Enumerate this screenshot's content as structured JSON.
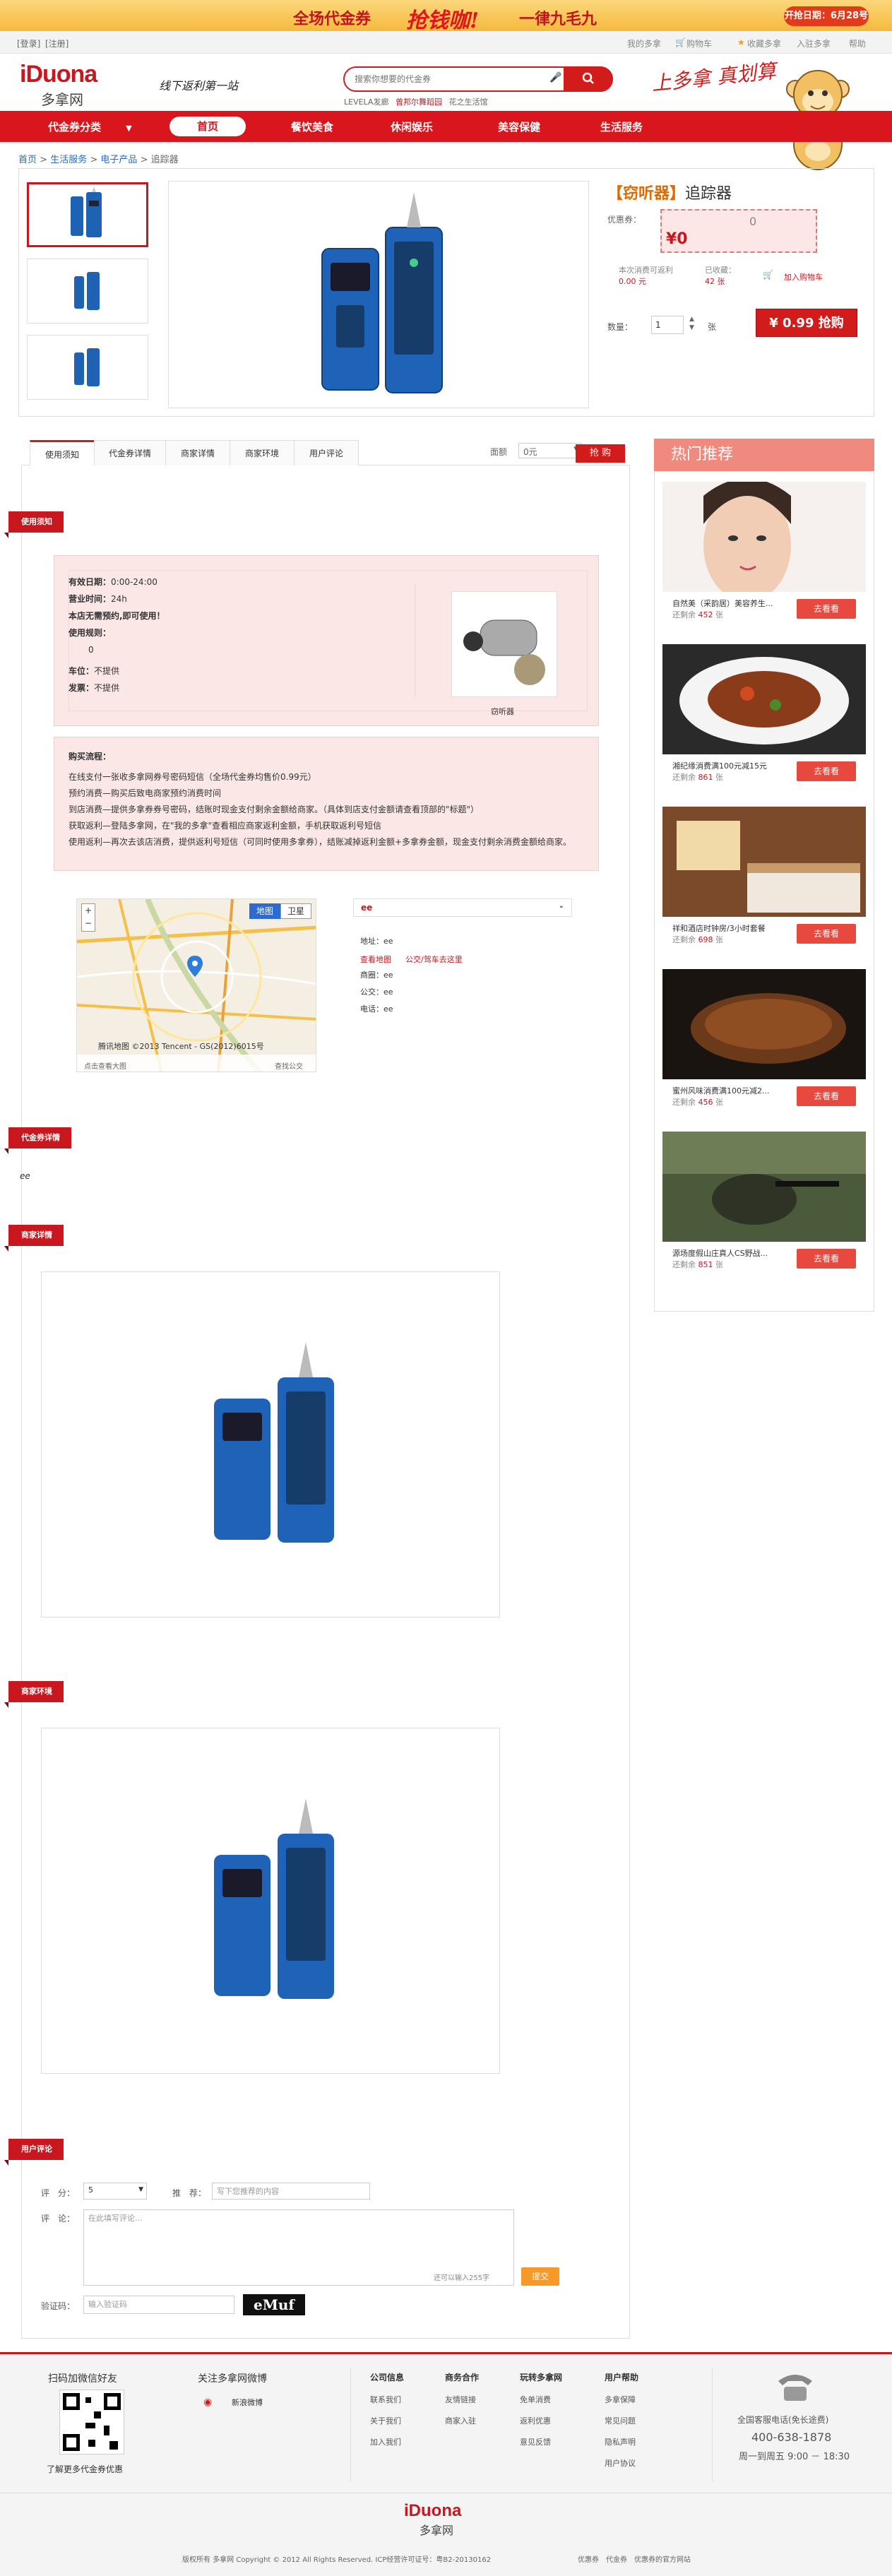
{
  "banner": {
    "left": "全场代金券",
    "mid": "抢钱咖!",
    "right": "一律九毛九",
    "date": "开抢日期：6月28号"
  },
  "topbar": {
    "login": "[登录]",
    "register": "[注册]",
    "my_account": "我的多拿",
    "cart": "购物车",
    "favorites": "收藏多拿",
    "join": "入驻多拿",
    "help": "帮助"
  },
  "header": {
    "logo_en": "iDuona",
    "logo_cn": "多拿网",
    "slogan": "线下返利第一站",
    "search_placeholder": "搜索你想要的代金券",
    "hot_words_1": "LEVELA发廊",
    "hot_words_2": "曾邦尔舞蹈园",
    "hot_words_3": "花之生活馆",
    "promo_text": "上多拿 真划算"
  },
  "nav": {
    "categories": "代金券分类",
    "home": "首页",
    "items": [
      "餐饮美食",
      "休闲娱乐",
      "美容保健",
      "生活服务"
    ]
  },
  "breadcrumb": {
    "home": "首页",
    "sep": ">",
    "l1": "生活服务",
    "l2": "电子产品",
    "l3": "追踪器"
  },
  "product": {
    "brand": "【窃听器】",
    "name": "追踪器",
    "coupon_label": "优惠券：",
    "coupon_value": "0",
    "price": "¥0",
    "stat1_label": "本次消费可返利",
    "stat1_value": "0.00 元",
    "stat2_label": "已收藏：",
    "stat2_value": "42 张",
    "add_cart": "加入购物车",
    "qty_label": "数量：",
    "qty_value": "1",
    "qty_unit": "张",
    "buy_label": "¥ 0.99 抢购"
  },
  "tabs": {
    "items": [
      "使用须知",
      "代金券详情",
      "商家详情",
      "商家环境",
      "用户评论"
    ],
    "price_label": "面额",
    "price_value": "0元",
    "buy": "抢 购"
  },
  "notice": {
    "tag": "使用须知",
    "lines": [
      {
        "k": "有效日期：",
        "v": "0:00-24:00"
      },
      {
        "k": "营业时间：",
        "v": "24h"
      },
      {
        "k": "本店无需预约,即可使用！",
        "v": ""
      },
      {
        "k": "使用规则：",
        "v": ""
      },
      {
        "k": "",
        "v": "0"
      },
      {
        "k": "车位：",
        "v": "不提供"
      },
      {
        "k": "发票：",
        "v": "不提供"
      }
    ],
    "img_caption": "窃听器",
    "flow_title": "购买流程：",
    "flow": [
      "在线支付一张收多拿网券号密码短信（全场代金券均售价0.99元）",
      "预约消费—购买后致电商家预约消费时间",
      "到店消费—提供多拿券券号密码，结账时现金支付剩余金额给商家。（具体到店支付金额请查看顶部的\"标题\"）",
      "获取返利—登陆多拿网，在\"我的多拿\"查看相应商家返利金额，手机获取返利号短信",
      "使用返利—再次去该店消费，提供返利号短信（可同时使用多拿券），结账减掉返利金额+多拿券金额，现金支付剩余消费金额给商家。"
    ]
  },
  "map": {
    "btn_map": "地图",
    "btn_sat": "卫星",
    "copyright": "腾讯地图 ©2013 Tencent - GS(2012)6015号",
    "view_large": "点击查看大图",
    "nearby": "查找公交"
  },
  "shop_info": {
    "name": "ee",
    "link1": "查看地图",
    "link2": "公交/驾车去这里",
    "addr_label": "地址：",
    "addr": "ee",
    "area_label": "商圈：",
    "area": "ee",
    "bus_label": "公交：",
    "bus": "ee",
    "tel_label": "电话：",
    "tel": "ee"
  },
  "coupon_detail": {
    "tag": "代金券详情",
    "text": "ee"
  },
  "merchant_detail": {
    "tag": "商家详情"
  },
  "merchant_env": {
    "tag": "商家环境"
  },
  "comments": {
    "tag": "用户评论",
    "score_label": "评　分：",
    "score_value": "5",
    "recommend_label": "推　荐：",
    "recommend_placeholder": "写下您推荐的内容",
    "comment_label": "评　论：",
    "comment_placeholder": "在此填写评论...",
    "remaining": "还可以输入255字",
    "submit": "提交",
    "captcha_label": "验证码：",
    "captcha_placeholder": "输入验证码",
    "captcha_img": "eMuf"
  },
  "sidebar": {
    "title": "热门推荐",
    "go": "去看看",
    "remain_label": "还剩余",
    "items": [
      {
        "name": "自然美（采韵居）美容养生...",
        "remain": "452",
        "unit": "张"
      },
      {
        "name": "湘纪缘消费满100元减15元",
        "remain": "861",
        "unit": "张"
      },
      {
        "name": "祥和酒店时钟房/3小时套餐",
        "remain": "698",
        "unit": "张"
      },
      {
        "name": "蜜州风味消费满100元减2...",
        "remain": "456",
        "unit": "张"
      },
      {
        "name": "源场度假山庄真人CS野战...",
        "remain": "851",
        "unit": "张"
      }
    ]
  },
  "footer": {
    "weixin_title": "扫码加微信好友",
    "weixin_more": "了解更多代金券优惠",
    "weibo_title": "关注多拿网微博",
    "weibo_name": "新浪微博",
    "cols": [
      {
        "title": "公司信息",
        "items": [
          "联系我们",
          "关于我们",
          "加入我们"
        ]
      },
      {
        "title": "商务合作",
        "items": [
          "友情链接",
          "商家入驻"
        ]
      },
      {
        "title": "玩转多拿网",
        "items": [
          "免单消费",
          "返利优惠",
          "意见反馈"
        ]
      },
      {
        "title": "用户帮助",
        "items": [
          "多拿保障",
          "常见问题",
          "隐私声明",
          "用户协议"
        ]
      }
    ],
    "hotline_label": "全国客服电话(免长途费)",
    "hotline": "400-638-1878",
    "hours": "周一到周五 9:00 － 18:30",
    "logo_en": "iDuona",
    "logo_cn": "多拿网",
    "copyright": "版权所有 多拿网 Copyright © 2012 All Rights Reserved. ICP经营许可证号：粤B2-20130162",
    "links": "优惠券　代金券　优惠券的官方网站"
  },
  "colors": {
    "brand_red": "#d21c1c",
    "accent_orange": "#e06a00",
    "side_head": "#f08a7e",
    "note_bg": "#fce7e7"
  }
}
